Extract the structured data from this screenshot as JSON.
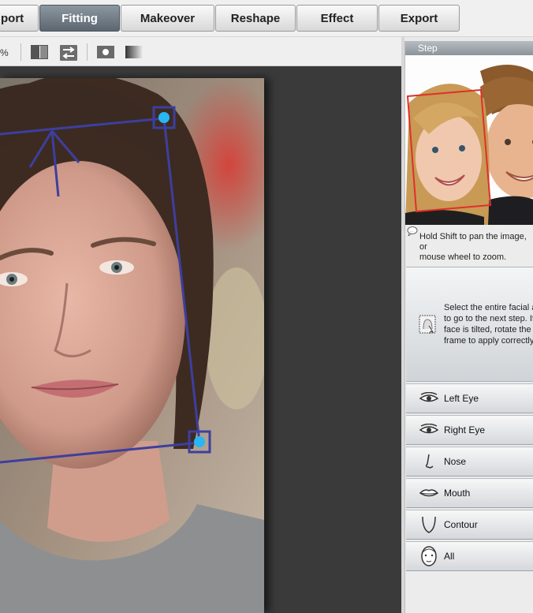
{
  "tabs": [
    {
      "label": "port",
      "active": false
    },
    {
      "label": "Fitting",
      "active": true
    },
    {
      "label": "Makeover",
      "active": false
    },
    {
      "label": "Reshape",
      "active": false
    },
    {
      "label": "Effect",
      "active": false
    },
    {
      "label": "Export",
      "active": false
    }
  ],
  "toolbar": {
    "zoom_fragment": "%",
    "icons": [
      "split-view-icon",
      "swap-icon",
      "circle-mask-icon",
      "gradient-icon"
    ]
  },
  "panel": {
    "step_label": "Step",
    "hint": {
      "line1": "Hold Shift to pan the image, or",
      "line2": "mouse wheel to zoom."
    },
    "select_instruction": {
      "line1": "Select the entire facial a",
      "line2": "to go to the next step. If",
      "line3": "face is tilted, rotate the",
      "line4": "frame to apply correctly"
    },
    "features": [
      {
        "label": "Left Eye",
        "icon": "eye-icon"
      },
      {
        "label": "Right Eye",
        "icon": "eye-icon"
      },
      {
        "label": "Nose",
        "icon": "nose-icon"
      },
      {
        "label": "Mouth",
        "icon": "mouth-icon"
      },
      {
        "label": "Contour",
        "icon": "contour-icon"
      },
      {
        "label": "All",
        "icon": "face-icon"
      }
    ]
  },
  "colors": {
    "canvas_bg": "#3a3a3a",
    "fitting_frame": "#3d3f9e",
    "handle": "#29b6f2",
    "preview_face_box": "#e0302a"
  }
}
